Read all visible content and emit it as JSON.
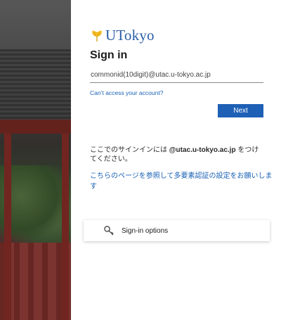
{
  "brand": {
    "name": "UTokyo",
    "color": "#2a5ea8",
    "logo_icon": "ginkgo-leaf-icon"
  },
  "signin": {
    "title": "Sign in",
    "email_value": "commonid(10digit)@utac.u-tokyo.ac.jp",
    "cant_access_link": "Can’t access your account?",
    "next_label": "Next"
  },
  "info": {
    "text_prefix": "ここでのサインインには ",
    "domain": "@utac.u-tokyo.ac.jp",
    "text_suffix": " をつけてください。",
    "mfa_link": "こちらのページを参照して多要素認証の設定をお願いします"
  },
  "options": {
    "label": "Sign-in options",
    "icon": "key-icon"
  },
  "colors": {
    "accent": "#1e60b6",
    "link": "#1a62b5"
  }
}
